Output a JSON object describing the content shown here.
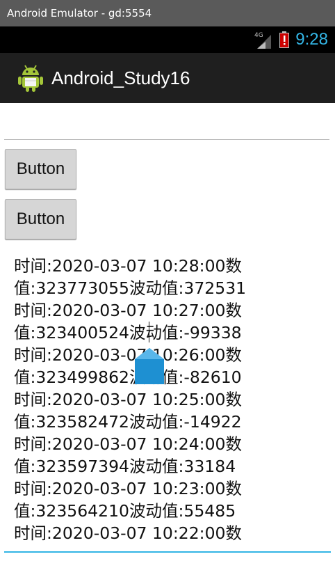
{
  "window": {
    "title": "Android Emulator - gd:5554"
  },
  "status_bar": {
    "network": "4G",
    "time": "9:28",
    "accent": "#33b5e5"
  },
  "action_bar": {
    "app_title": "Android_Study16",
    "icon": "android-robot-icon"
  },
  "edit_text_top": {
    "value": "",
    "placeholder": ""
  },
  "buttons": [
    {
      "label": "Button"
    },
    {
      "label": "Button"
    }
  ],
  "log_text": {
    "lines": [
      "时间:2020-03-07 10:28:00数",
      "值:323773055波动值:372531",
      "时间:2020-03-07 10:27:00数",
      "值:323400524波动值:-99338",
      "时间:2020-03-07 10:26:00数",
      "值:323499862波动值:-82610",
      "时间:2020-03-07 10:25:00数",
      "值:323582472波动值:-14922",
      "时间:2020-03-07 10:24:00数",
      "值:323597394波动值:33184",
      "时间:2020-03-07 10:23:00数",
      "值:323564210波动值:55485",
      "时间:2020-03-07 10:22:00数"
    ]
  }
}
